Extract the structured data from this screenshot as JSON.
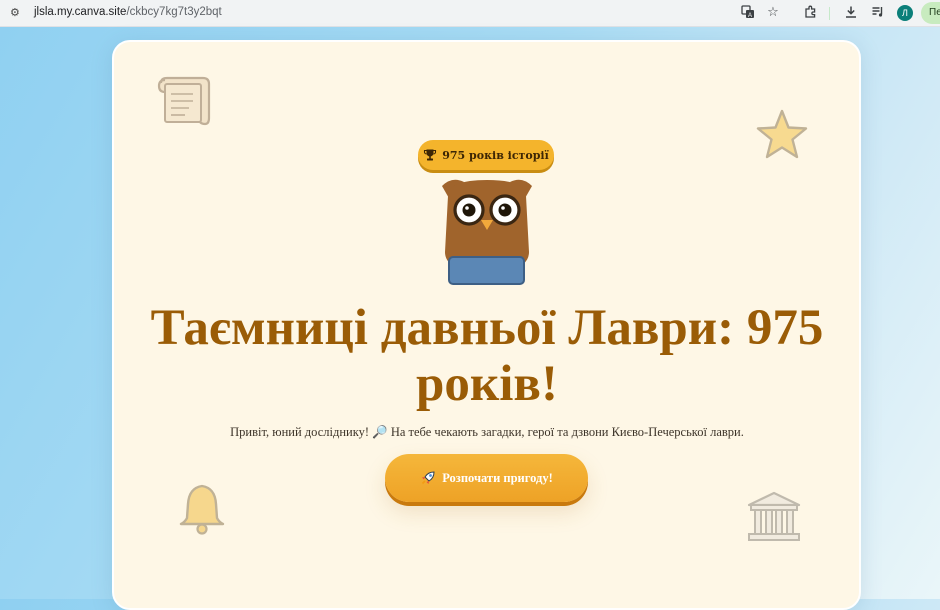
{
  "browser": {
    "url_host": "jlsla.my.canva.site",
    "url_path": "/ckbcy7kg7t3y2bqt",
    "avatar_letter": "Л",
    "profile_label": "Пе"
  },
  "hero": {
    "badge_text": "975 років історії",
    "title": "Таємниці давньої Лаври: 975 років!",
    "subtitle": "Привіт, юний досліднику! 🔎 На тебе чекають загадки, герої та дзвони Києво-Печерської лаври.",
    "cta_label": "Розпочати пригоду!"
  },
  "colors": {
    "card_background": "#fef7e6",
    "title": "#9a5c06",
    "accent_orange": "#f4b42c",
    "owl_body": "#a0642c",
    "owl_scarf": "#5b87b5"
  },
  "icons": {
    "badge_icon": "trophy-icon",
    "cta_icon": "rocket-icon",
    "decorations": [
      "scroll-icon",
      "star-icon",
      "bell-icon",
      "monument-icon"
    ]
  }
}
